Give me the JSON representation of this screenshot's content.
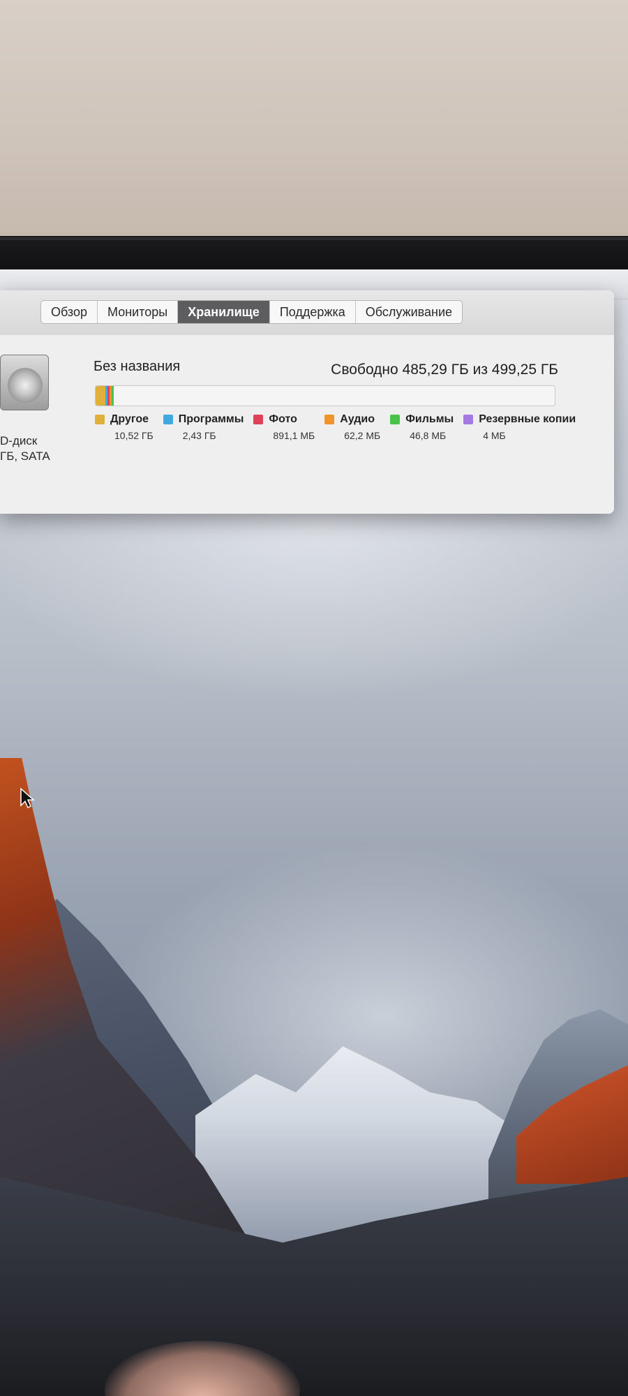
{
  "tabs": [
    "Обзор",
    "Мониторы",
    "Хранилище",
    "Поддержка",
    "Обслуживание"
  ],
  "active_tab": "Хранилище",
  "disk": {
    "line1": "D-диск",
    "line2": "ГБ, SATA"
  },
  "volume": {
    "name": "Без названия",
    "free_text": "Свободно 485,29 ГБ из 499,25 ГБ"
  },
  "categories": [
    {
      "name": "Другое",
      "size": "10,52 ГБ",
      "color": "#e0b13a"
    },
    {
      "name": "Программы",
      "size": "2,43 ГБ",
      "color": "#3fa9e0"
    },
    {
      "name": "Фото",
      "size": "891,1 МБ",
      "color": "#e0425a"
    },
    {
      "name": "Аудио",
      "size": "62,2 МБ",
      "color": "#f0932b"
    },
    {
      "name": "Фильмы",
      "size": "46,8 МБ",
      "color": "#4bc24b"
    },
    {
      "name": "Резервные копии",
      "size": "4 МБ",
      "color": "#a57ae0"
    }
  ],
  "usage_fraction": {
    "other": 0.0211,
    "apps": 0.0049,
    "photos": 0.0018,
    "audio": 0.0001,
    "movies": 0.0001,
    "backups": 0.0
  }
}
